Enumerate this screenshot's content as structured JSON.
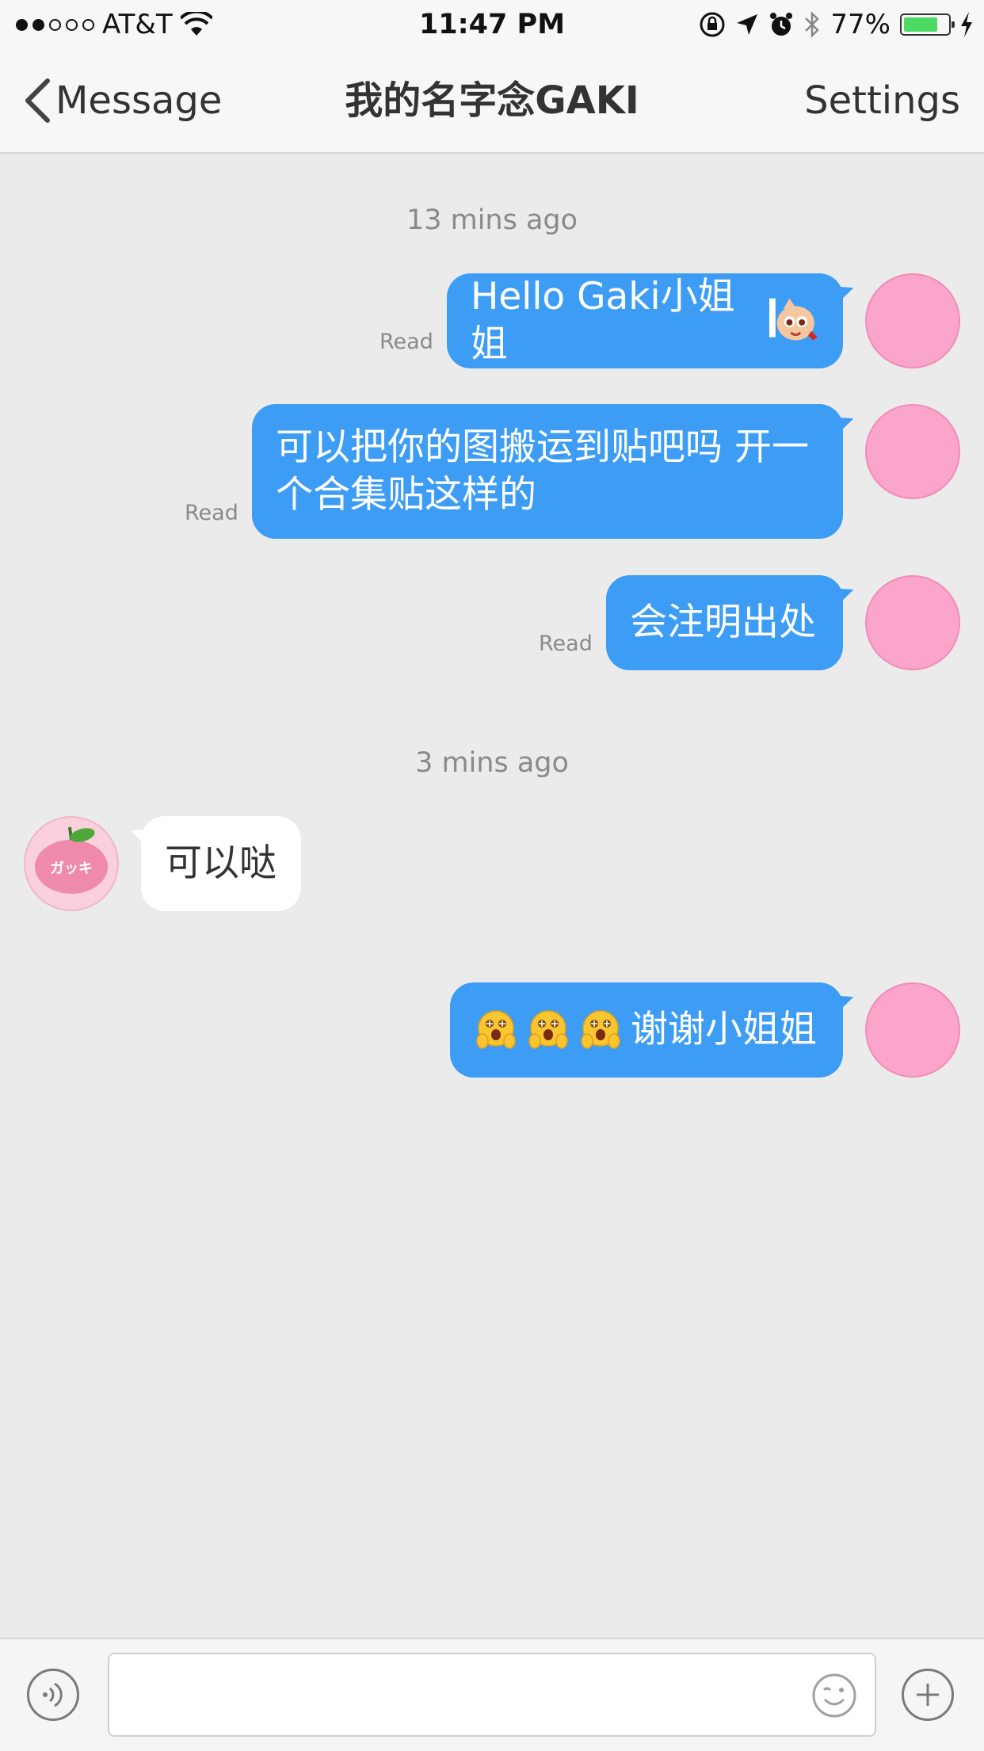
{
  "status_bar": {
    "carrier": "AT&T",
    "time": "11:47 PM",
    "battery_percent": "77%",
    "battery_level": 0.77,
    "signal_bars_filled": 2,
    "signal_bars_total": 5,
    "icons": [
      "wifi-icon",
      "rotation-lock-icon",
      "location-icon",
      "alarm-icon",
      "bluetooth-icon",
      "battery-icon",
      "charging-icon"
    ]
  },
  "nav": {
    "back_label": "Message",
    "title": "我的名字念GAKI",
    "settings_label": "Settings"
  },
  "conversation": {
    "timestamps": [
      "13 mins ago",
      "3 mins ago"
    ],
    "messages": [
      {
        "direction": "out",
        "text": "Hello Gaki小姐姐",
        "status": "Read",
        "sticker": "cartoon-sticker-icon"
      },
      {
        "direction": "out",
        "lines": [
          "可以把你的图搬运到贴吧吗 开一",
          "个合集贴这样的"
        ],
        "status": "Read"
      },
      {
        "direction": "out",
        "text": "会注明出处",
        "status": "Read"
      },
      {
        "direction": "in",
        "text": "可以哒",
        "avatar_label": "ガッキ"
      },
      {
        "direction": "out",
        "text": "谢谢小姐姐",
        "emojis": [
          "hugging-face-icon",
          "hugging-face-icon",
          "hugging-face-icon"
        ]
      }
    ]
  },
  "colors": {
    "outgoing_bubble": "#3d9df5",
    "incoming_bubble": "#ffffff",
    "background": "#ebebeb",
    "avatar_pink": "#fca5cb"
  },
  "input_bar": {
    "placeholder": "",
    "icons": [
      "voice-icon",
      "emoji-icon",
      "add-icon"
    ]
  }
}
